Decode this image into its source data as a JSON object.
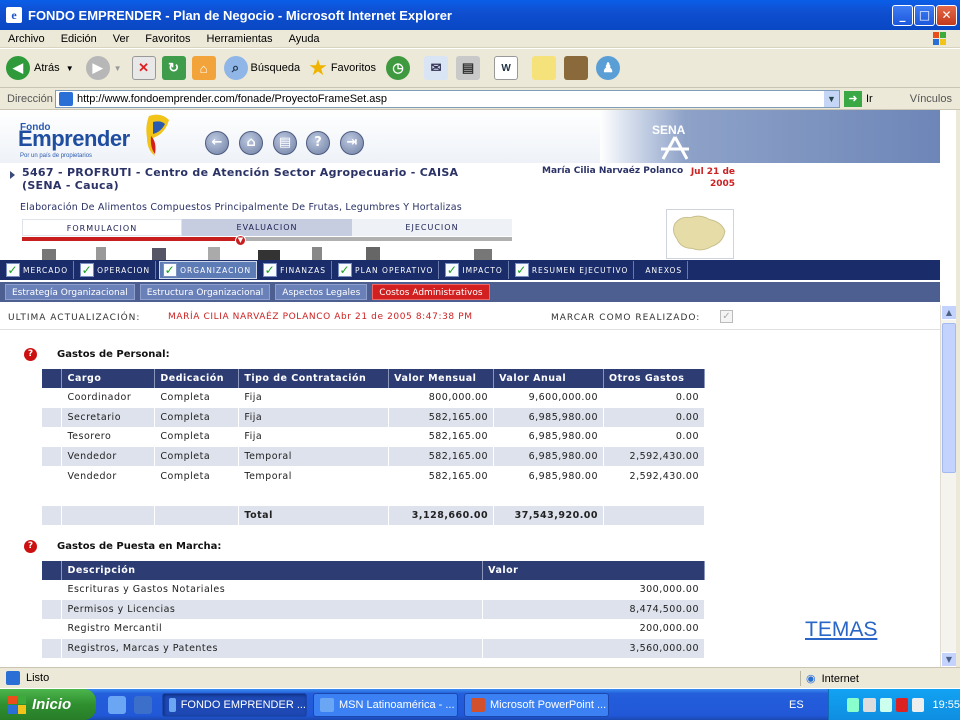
{
  "window": {
    "title": "FONDO EMPRENDER - Plan de Negocio - Microsoft Internet Explorer",
    "min": "_",
    "max": "□",
    "close": "✕"
  },
  "menu": [
    "Archivo",
    "Edición",
    "Ver",
    "Favoritos",
    "Herramientas",
    "Ayuda"
  ],
  "toolbar": {
    "back": "Atrás",
    "search": "Búsqueda",
    "favorites": "Favoritos"
  },
  "address": {
    "label": "Dirección",
    "url": "http://www.fondoemprender.com/fonade/ProyectoFrameSet.asp",
    "go": "Ir",
    "links": "Vínculos"
  },
  "header": {
    "logo_small": "Fondo",
    "logo_big": "Emprender",
    "logo_tag": "Por un país de propietarios",
    "sena": "SENA"
  },
  "project": {
    "title": "5467 - PROFRUTI - Centro de Atención Sector Agropecuario - CAISA (SENA - Cauca)",
    "person": "María Cilia Narvaéz Polanco",
    "date": "Jul 21 de 2005",
    "subtitle": "Elaboración De Alimentos Compuestos Principalmente De Frutas, Legumbres Y Hortalizas"
  },
  "phases": [
    "FORMULACION",
    "EVALUACION",
    "EJECUCION"
  ],
  "module_tabs": [
    "MERCADO",
    "OPERACION",
    "ORGANIZACION",
    "FINANZAS",
    "PLAN OPERATIVO",
    "IMPACTO",
    "RESUMEN EJECUTIVO",
    "ANEXOS"
  ],
  "sub_tabs": [
    "Estrategía Organizacional",
    "Estructura Organizacional",
    "Aspectos Legales",
    "Costos Administrativos"
  ],
  "update": {
    "label": "ULTIMA ACTUALIZACIÓN:",
    "value": "MARÍA CILIA NARVAÉZ POLANCO  Abr 21 de 2005 8:47:38 PM",
    "mark_label": "MARCAR COMO REALIZADO:",
    "mark_checked": "✓"
  },
  "personal": {
    "title": "Gastos de Personal:",
    "headers": [
      "Cargo",
      "Dedicación",
      "Tipo de Contratación",
      "Valor Mensual",
      "Valor Anual",
      "Otros Gastos"
    ],
    "rows": [
      [
        "Coordinador",
        "Completa",
        "Fija",
        "800,000.00",
        "9,600,000.00",
        "0.00"
      ],
      [
        "Secretario",
        "Completa",
        "Fija",
        "582,165.00",
        "6,985,980.00",
        "0.00"
      ],
      [
        "Tesorero",
        "Completa",
        "Fija",
        "582,165.00",
        "6,985,980.00",
        "0.00"
      ],
      [
        "Vendedor",
        "Completa",
        "Temporal",
        "582,165.00",
        "6,985,980.00",
        "2,592,430.00"
      ],
      [
        "Vendedor",
        "Completa",
        "Temporal",
        "582,165.00",
        "6,985,980.00",
        "2,592,430.00"
      ]
    ],
    "total_label": "Total",
    "total_monthly": "3,128,660.00",
    "total_annual": "37,543,920.00"
  },
  "startup": {
    "title": "Gastos de Puesta en Marcha:",
    "headers": [
      "Descripción",
      "Valor"
    ],
    "rows": [
      [
        "Escrituras y Gastos Notariales",
        "300,000.00"
      ],
      [
        "Permisos y Licencias",
        "8,474,500.00"
      ],
      [
        "Registro Mercantil",
        "200,000.00"
      ],
      [
        "Registros, Marcas y Patentes",
        "3,560,000.00"
      ]
    ]
  },
  "temas": "TEMAS",
  "status": {
    "left": "Listo",
    "zone": "Internet"
  },
  "taskbar": {
    "start": "Inicio",
    "tasks": [
      "FONDO EMPRENDER ...",
      "MSN Latinoamérica - ...",
      "Microsoft PowerPoint ..."
    ],
    "lang": "ES",
    "clock": "19:55"
  },
  "colors": {
    "navy": "#2d3d73",
    "red": "#cc2222",
    "link": "#2a66c7"
  }
}
